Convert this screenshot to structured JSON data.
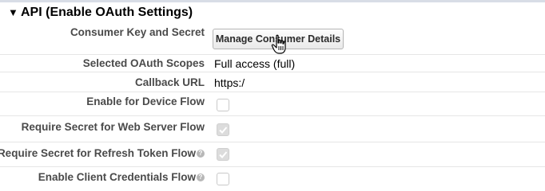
{
  "section": {
    "title": "API (Enable OAuth Settings)",
    "collapse_icon": "triangle-down-icon"
  },
  "fields": {
    "consumer_key": {
      "label": "Consumer Key and Secret",
      "button_label": "Manage Consumer Details"
    },
    "oauth_scopes": {
      "label": "Selected OAuth Scopes",
      "value": "Full access (full)"
    },
    "callback_url": {
      "label": "Callback URL",
      "value": "https:/"
    },
    "device_flow": {
      "label": "Enable for Device Flow",
      "checked": false,
      "enabled": true
    },
    "secret_web_server": {
      "label": "Require Secret for Web Server Flow",
      "checked": true,
      "enabled": false
    },
    "secret_refresh_token": {
      "label": "Require Secret for Refresh Token Flow",
      "checked": true,
      "enabled": false,
      "help_icon": "help-icon"
    },
    "client_credentials": {
      "label": "Enable Client Credentials Flow",
      "checked": false,
      "enabled": true,
      "help_icon": "help-icon"
    }
  },
  "cursor_icon": "hand-pointer-icon"
}
